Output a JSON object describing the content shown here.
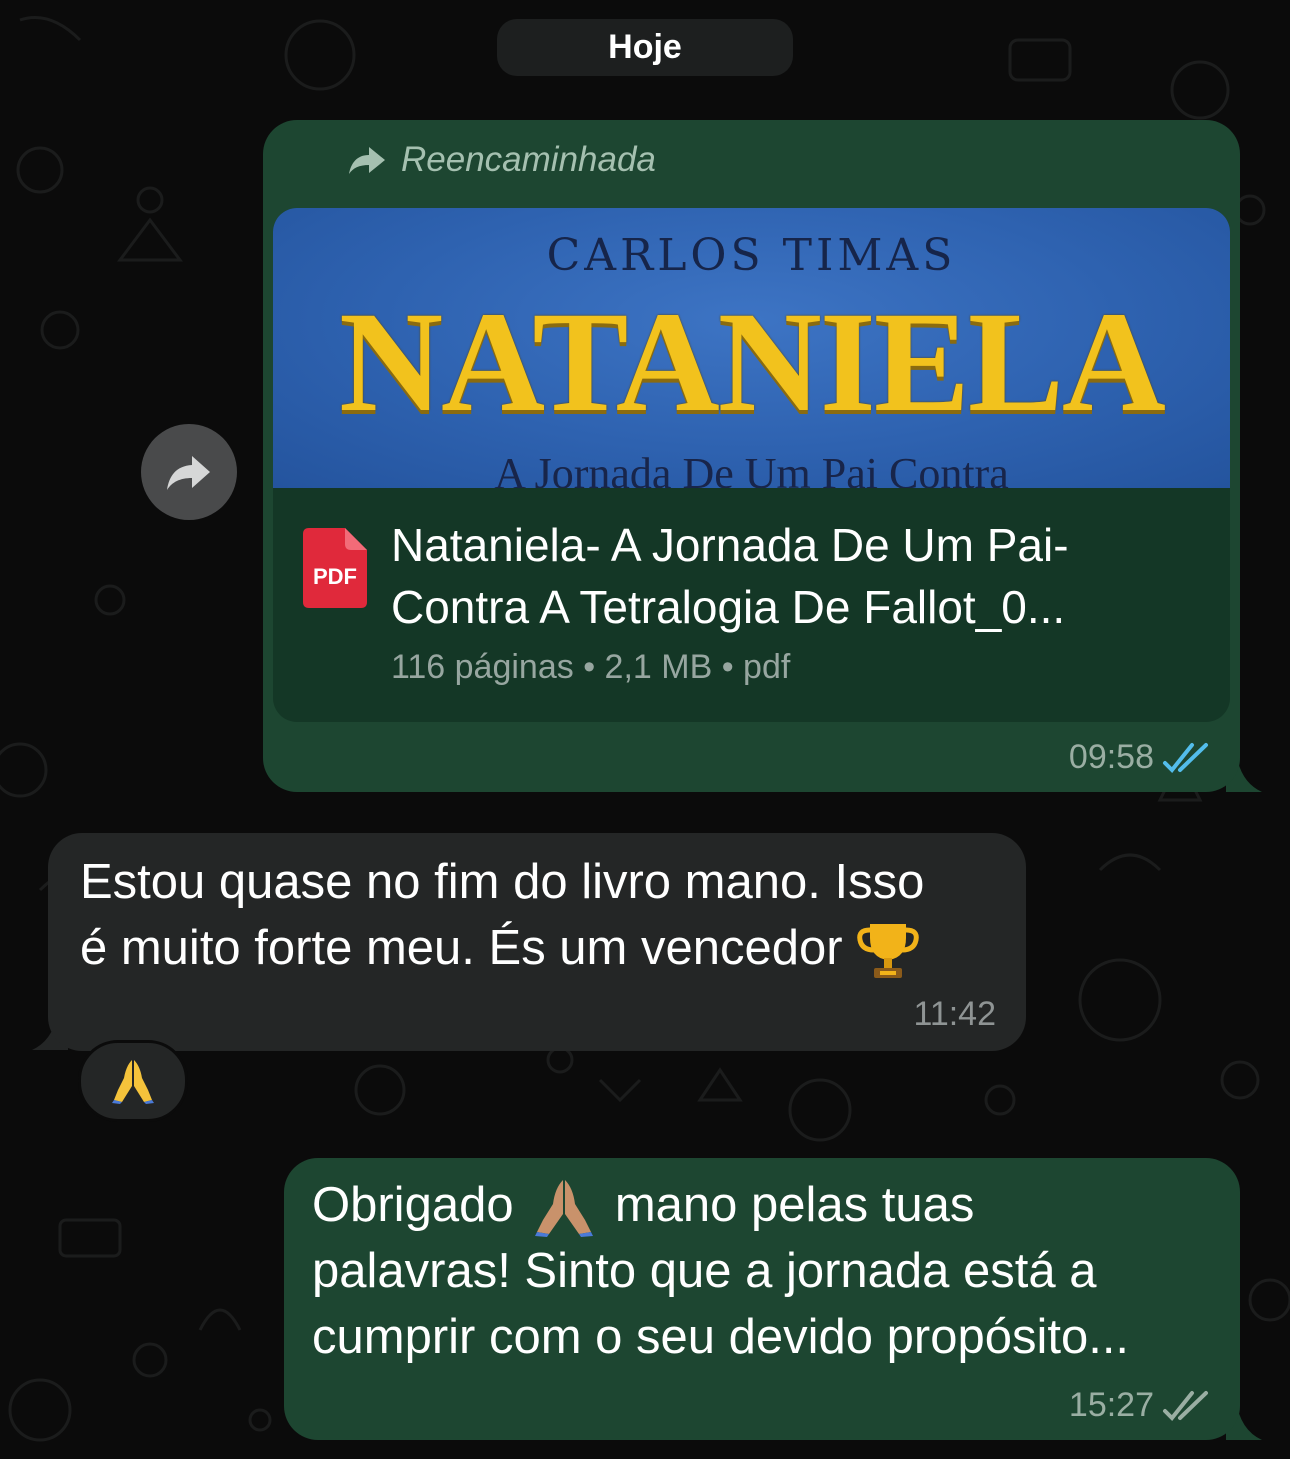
{
  "date_separator": "Hoje",
  "messages": [
    {
      "direction": "outgoing",
      "forwarded_label": "Reencaminhada",
      "document": {
        "cover": {
          "author": "CARLOS TIMAS",
          "title": "NATANIELA",
          "subtitle": "A Jornada De Um Pai Contra"
        },
        "file_icon": "pdf-icon",
        "file_icon_label": "PDF",
        "name_line1": "Nataniela- A Jornada De Um Pai-",
        "name_line2": "Contra A Tetralogia De Fallot_0...",
        "meta": "116 páginas • 2,1 MB • pdf"
      },
      "time": "09:58",
      "status": "read",
      "status_color": "#53bdeb"
    },
    {
      "direction": "incoming",
      "text_line1": "Estou quase no fim do livro mano. Isso",
      "text_line2": "é muito forte meu. És um vencedor",
      "emoji": "trophy",
      "time": "11:42",
      "reaction": "folded-hands"
    },
    {
      "direction": "outgoing",
      "text_line1_a": "Obrigado",
      "emoji": "folded-hands-medium-skin",
      "text_line1_b": "mano pelas tuas",
      "text_line2": "palavras! Sinto que a jornada está a",
      "text_line3": "cumprir com o seu devido propósito...",
      "time": "15:27",
      "status": "delivered",
      "status_color": "#9aaea3"
    }
  ],
  "colors": {
    "background": "#0b0b0b",
    "outgoing_bubble": "#1d4631",
    "incoming_bubble": "#242626",
    "pdf_red": "#e0293b",
    "cover_gold": "#f2c21d"
  }
}
